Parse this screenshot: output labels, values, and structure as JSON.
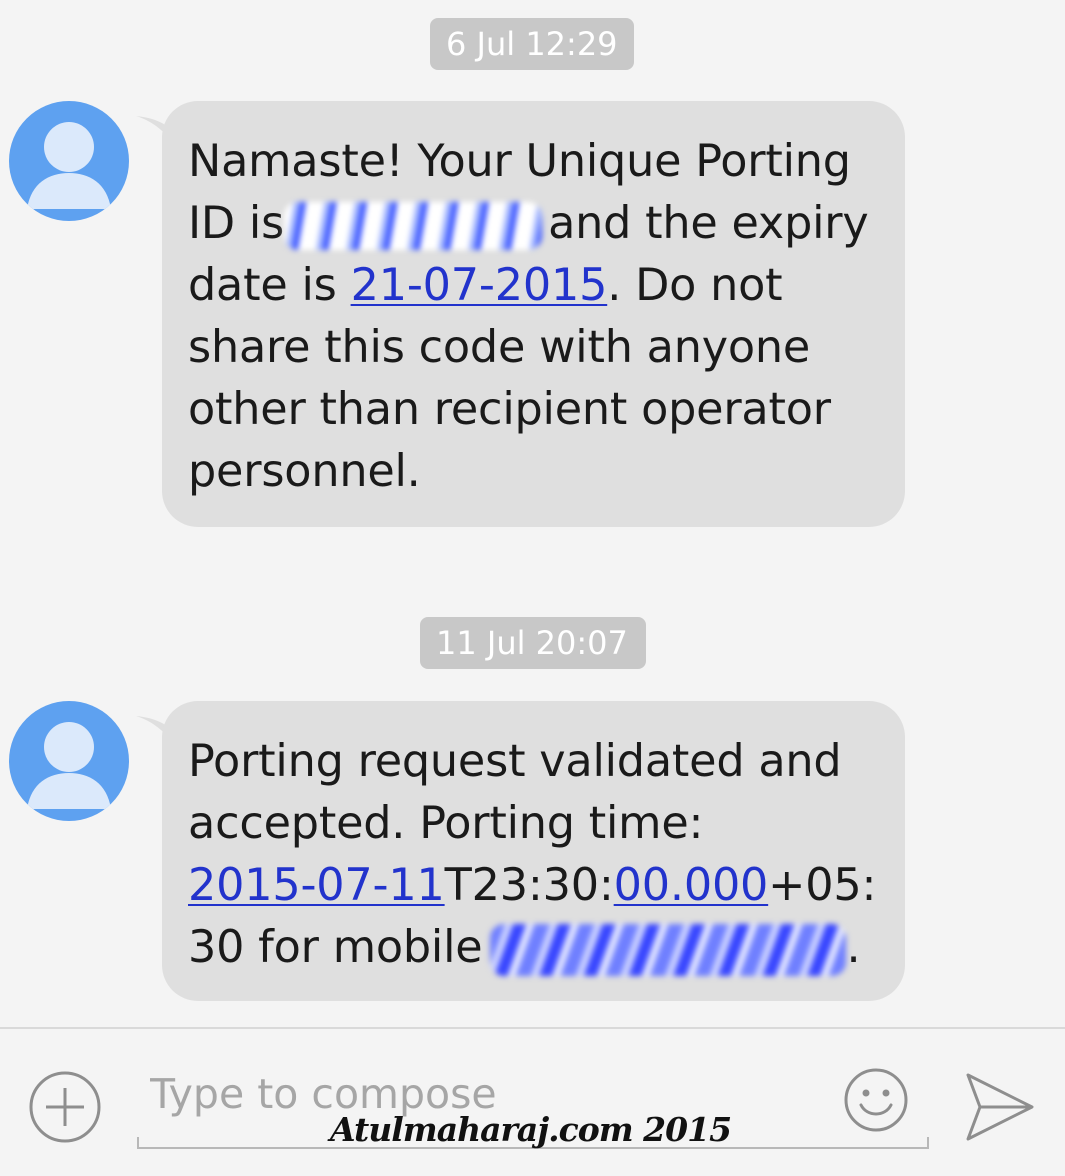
{
  "messages": [
    {
      "timestamp": "6 Jul 12:29",
      "lines": {
        "l1": "Namaste! Your Unique Porting",
        "l2_before": "ID is",
        "l2_after": "and the expiry",
        "l3_before": "date is ",
        "l3_link": "21-07-2015",
        "l3_after": ". Do not",
        "l4": "share this code with anyone",
        "l5": "other than recipient operator",
        "l6": "personnel."
      }
    },
    {
      "timestamp": "11 Jul 20:07",
      "lines": {
        "l1": "Porting request validated and",
        "l2": "accepted. Porting time:",
        "l3_link1": "2015-07-11",
        "l3_mid": "T23:30:",
        "l3_link2": "00.000",
        "l3_after": "+05:",
        "l4_before": "30 for mobile",
        "l4_after": "."
      }
    }
  ],
  "composer": {
    "placeholder": "Type to compose",
    "icons": {
      "attach": "plus-circle-icon",
      "emoji": "smiley-icon",
      "send": "send-arrow-icon"
    }
  },
  "watermark": "Atulmaharaj.com 2015",
  "colors": {
    "background": "#f4f4f4",
    "bubble": "#dfdfdf",
    "timestamp_bg": "#c8c8c8",
    "avatar": "#5ea1f0",
    "link": "#2233cc"
  }
}
